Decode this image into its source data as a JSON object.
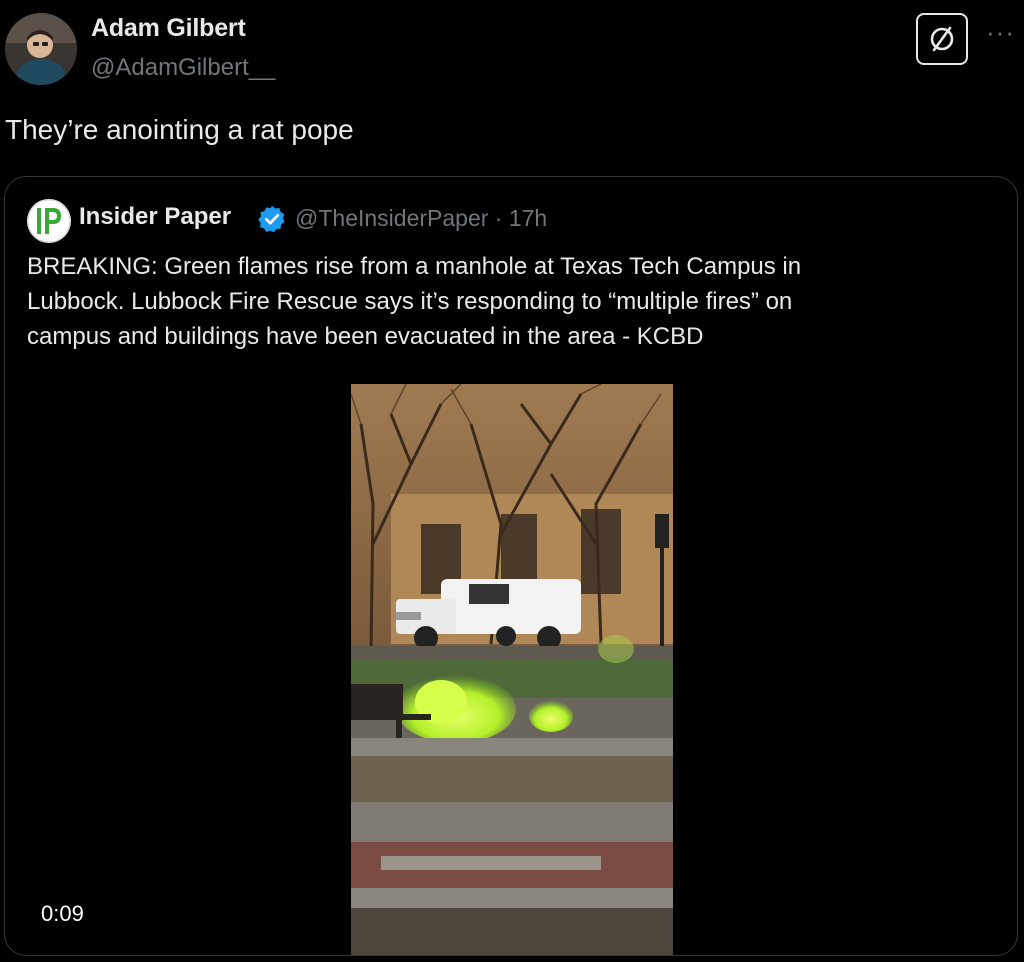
{
  "tweet": {
    "author_name": "Adam Gilbert",
    "author_handle": "@AdamGilbert__",
    "text": "They’re anointing a rat pope",
    "more_label": "···"
  },
  "quote": {
    "author_name": "Insider Paper",
    "author_handle": "@TheInsiderPaper",
    "time": "17h",
    "lines": [
      "BREAKING: Green flames rise from a manhole at Texas Tech Campus in",
      "Lubbock. Lubbock Fire Rescue says it’s responding to “multiple fires” on",
      "campus and buildings have been evacuated in the area - KCBD"
    ],
    "video_time": "0:09",
    "logo_text": "IP"
  },
  "colors": {
    "background": "#000000",
    "text": "#e7e9ea",
    "muted": "#71767b",
    "border": "#333639",
    "verified": "#1d9bf0",
    "flame": "#b4f02a",
    "logo_green": "#3aa935"
  },
  "icons": {
    "grok": "slashed-circle-icon",
    "more": "more-dots-icon",
    "verified": "verified-badge-icon"
  }
}
